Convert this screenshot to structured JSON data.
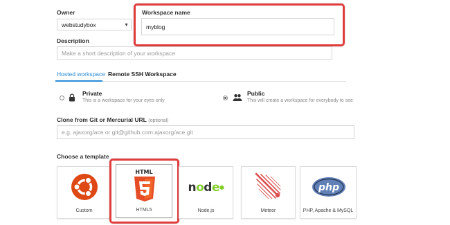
{
  "owner": {
    "label": "Owner",
    "value": "webstudybox"
  },
  "workspace_name": {
    "label": "Workspace name",
    "value": "myblog"
  },
  "description": {
    "label": "Description",
    "placeholder": "Make a short description of your workspace"
  },
  "tabs": [
    {
      "label": "Hosted workspace",
      "active": true
    },
    {
      "label": "Remote SSH Workspace",
      "active": false
    }
  ],
  "visibility": {
    "private": {
      "title": "Private",
      "desc": "This is a workspace for your eyes only",
      "selected": false
    },
    "public": {
      "title": "Public",
      "desc": "This will create a workspace for everybody to see",
      "selected": true
    }
  },
  "clone": {
    "label": "Clone from Git or Mercurial URL",
    "optional": "(optional)",
    "placeholder": "e.g. ajaxorg/ace or git@github.com:ajaxorg/ace.git"
  },
  "template": {
    "label": "Choose a template",
    "items": [
      {
        "name": "Custom",
        "icon": "ubuntu-icon",
        "selected": false
      },
      {
        "name": "HTML5",
        "icon": "html5-icon",
        "selected": true
      },
      {
        "name": "Node.js",
        "icon": "nodejs-icon",
        "selected": false
      },
      {
        "name": "Meteor",
        "icon": "meteor-icon",
        "selected": false
      },
      {
        "name": "PHP, Apache & MySQL",
        "icon": "php-icon",
        "selected": false
      }
    ]
  },
  "colors": {
    "highlight": "#e03c3c",
    "tab_active": "#2a8bd8",
    "html5": "#e44d26",
    "ubuntu": "#dd4814",
    "node": "#83cd29",
    "meteor": "#de4f4f",
    "php": "#6181b6"
  }
}
